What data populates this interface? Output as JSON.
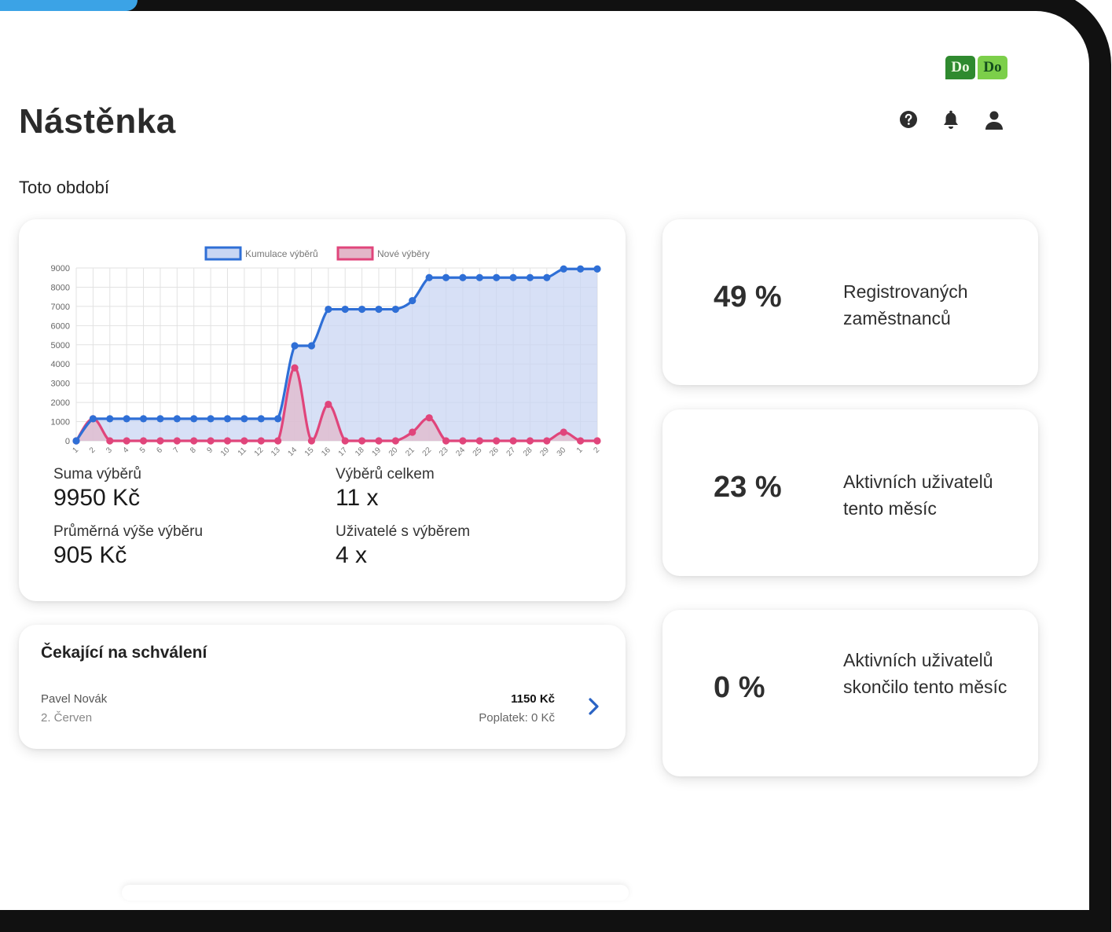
{
  "header": {
    "logo": [
      "Do",
      "Do"
    ],
    "title": "Nástěnka",
    "icons": [
      "help-icon",
      "bell-icon",
      "user-icon"
    ]
  },
  "period_label": "Toto období",
  "chart_card": {
    "stats": [
      {
        "label": "Suma výběrů",
        "value": "9950 Kč"
      },
      {
        "label": "Výběrů celkem",
        "value": "11 x"
      },
      {
        "label": "Průměrná výše výběru",
        "value": "905 Kč"
      },
      {
        "label": "Uživatelé s výběrem",
        "value": "4 x"
      }
    ]
  },
  "chart_data": {
    "type": "line",
    "x": [
      "1",
      "2",
      "3",
      "4",
      "5",
      "6",
      "7",
      "8",
      "9",
      "10",
      "11",
      "12",
      "13",
      "14",
      "15",
      "16",
      "17",
      "18",
      "19",
      "20",
      "21",
      "22",
      "23",
      "24",
      "25",
      "26",
      "27",
      "28",
      "29",
      "30",
      "1",
      "2"
    ],
    "ylim": [
      0,
      9000
    ],
    "yticks": [
      0,
      1000,
      2000,
      3000,
      4000,
      5000,
      6000,
      7000,
      8000,
      9000
    ],
    "legend_position": "top",
    "grid": true,
    "series": [
      {
        "name": "Kumulace výběrů",
        "color": "#2f6fd6",
        "fill": "#c9d6f3",
        "values": [
          0,
          1150,
          1150,
          1150,
          1150,
          1150,
          1150,
          1150,
          1150,
          1150,
          1150,
          1150,
          1150,
          4950,
          4950,
          6850,
          6850,
          6850,
          6850,
          6850,
          7300,
          8500,
          8500,
          8500,
          8500,
          8500,
          8500,
          8500,
          8500,
          8950,
          8950,
          8950
        ]
      },
      {
        "name": "Nové výběry",
        "color": "#e0457b",
        "fill": "#e3b7c9",
        "values": [
          0,
          1150,
          0,
          0,
          0,
          0,
          0,
          0,
          0,
          0,
          0,
          0,
          0,
          3800,
          0,
          1900,
          0,
          0,
          0,
          0,
          450,
          1200,
          0,
          0,
          0,
          0,
          0,
          0,
          0,
          450,
          0,
          0
        ]
      }
    ]
  },
  "pending": {
    "title": "Čekající na schválení",
    "items": [
      {
        "name": "Pavel Novák",
        "date": "2. Červen",
        "amount": "1150 Kč",
        "fee": "Poplatek: 0 Kč"
      }
    ]
  },
  "kpis": [
    {
      "value": "49 %",
      "label": "Registrovaných zaměstnanců"
    },
    {
      "value": "23 %",
      "label": "Aktivních uživatelů tento měsíc"
    },
    {
      "value": "0 %",
      "label": "Aktivních uživatelů skončilo tento měsíc"
    }
  ]
}
